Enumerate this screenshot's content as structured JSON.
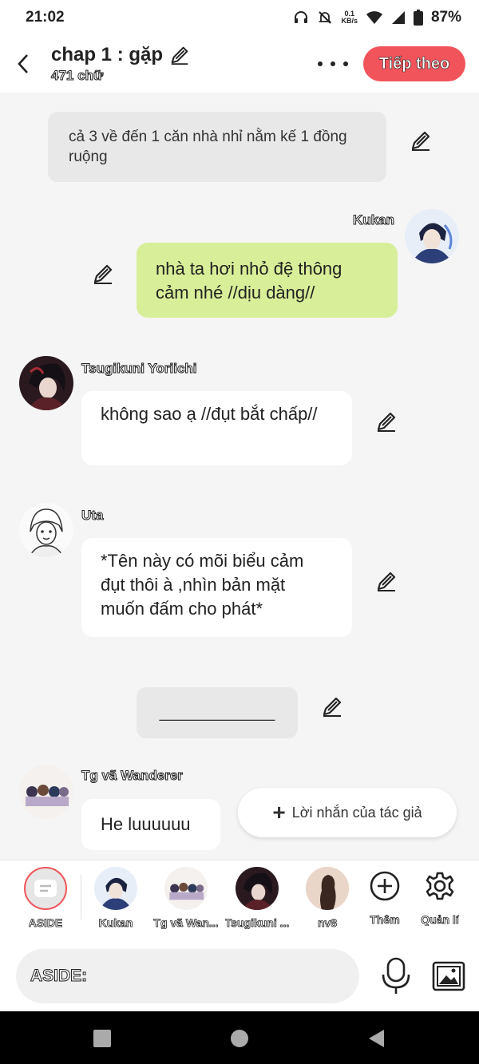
{
  "status_bar": {
    "time": "21:02",
    "net_speed_value": "0.1",
    "net_speed_unit": "KB/s",
    "battery": "87%"
  },
  "header": {
    "title": "chap 1 : gặp",
    "word_count": "471 chữ",
    "next_button": "Tiếp theo"
  },
  "messages": {
    "narration": "cả 3 về đến 1 căn nhà nhỉ nằm kế 1 đồng ruộng",
    "kukan_name": "Kukan",
    "kukan_text": "nhà ta hơi nhỏ đệ thông cảm nhé //dịu dàng//",
    "yoriichi_name": "Tsugikuni Yoriichi",
    "yoriichi_text": "không sao ạ //đụt bắt chấp//",
    "uta_name": "Uta",
    "uta_text": "*Tên này có mõi biểu cảm đụt thôi à ,nhìn bản mặt muốn đấm cho phát*",
    "divider_text": "_____________",
    "wanderer_name": "Tg vã Wanderer",
    "wanderer_text": "He luuuuuu"
  },
  "author_note_button": "Lời nhắn của tác giả",
  "character_bar": {
    "aside": "ASIDE",
    "kukan": "Kukan",
    "wanderer": "Tg vã Wan...",
    "yoriichi": "Tsugikuni ...",
    "nv8": "nv8",
    "more": "Thêm",
    "manage": "Quản lí"
  },
  "input": {
    "placeholder": "ASIDE:"
  },
  "colors": {
    "accent_red": "#f2545b",
    "bubble_green": "#d8ee98",
    "background": "#f5f5f5"
  }
}
